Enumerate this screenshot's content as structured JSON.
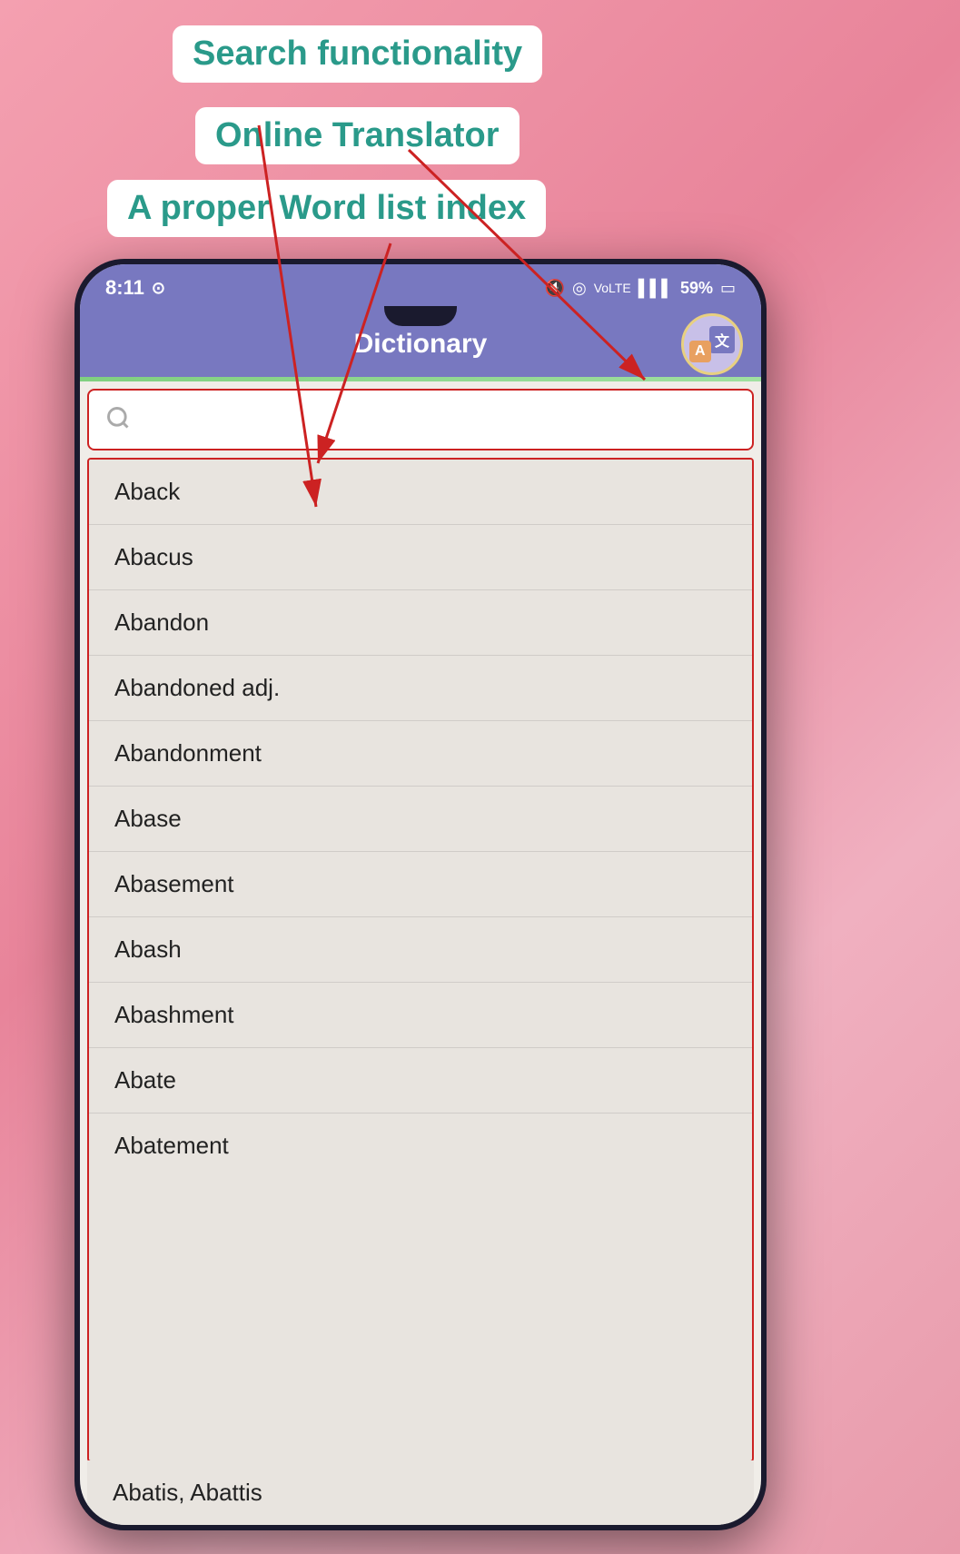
{
  "annotations": {
    "search_label": "Search functionality",
    "translator_label": "Online Translator",
    "wordlist_label": "A proper Word list index"
  },
  "status_bar": {
    "time": "8:11",
    "battery": "59%",
    "whatsapp_icon": "whatsapp-icon",
    "signal_icon": "signal-icon",
    "wifi_icon": "wifi-icon",
    "lte_icon": "lte-icon",
    "mute_icon": "mute-icon"
  },
  "app_bar": {
    "title": "Dictionary",
    "translate_button_label": "translate"
  },
  "search": {
    "placeholder": "",
    "search_icon": "search-icon"
  },
  "word_list": {
    "items": [
      "Aback",
      "Abacus",
      "Abandon",
      "Abandoned adj.",
      "Abandonment",
      "Abase",
      "Abasement",
      "Abash",
      "Abashment",
      "Abate",
      "Abatement"
    ],
    "overflow_item": "Abatis, Abattis"
  },
  "colors": {
    "accent_teal": "#2a9a8a",
    "app_bar_purple": "#7878c0",
    "red_border": "#cc2222",
    "annotation_bg": "#ffffff",
    "list_bg": "#e8e4df"
  }
}
